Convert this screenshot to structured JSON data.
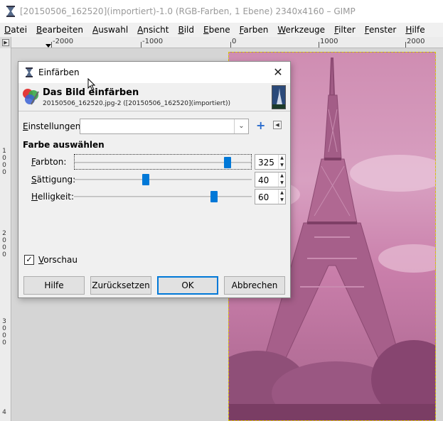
{
  "window": {
    "title": "[20150506_162520](importiert)-1.0 (RGB-Farben, 1 Ebene) 2340x4160 – GIMP"
  },
  "menubar": {
    "items": [
      "Datei",
      "Bearbeiten",
      "Auswahl",
      "Ansicht",
      "Bild",
      "Ebene",
      "Farben",
      "Werkzeuge",
      "Filter",
      "Fenster",
      "Hilfe"
    ]
  },
  "ruler": {
    "h_labels": [
      "-2000",
      "-1000",
      "0",
      "1000",
      "2000"
    ],
    "v_labels": [
      "1\n0\n0\n0",
      "2\n0\n0\n0",
      "3\n0\n0\n0",
      "4"
    ]
  },
  "dialog": {
    "title": "Einfärben",
    "header_title": "Das Bild einfärben",
    "header_subtitle": "20150506_162520.jpg-2 ([20150506_162520](importiert))",
    "settings_label": "Einstellungen:",
    "settings_value": "",
    "section_title": "Farbe auswählen",
    "sliders": [
      {
        "label": "Farbton:",
        "value": "325",
        "fraction": 0.883
      },
      {
        "label": "Sättigung:",
        "value": "40",
        "fraction": 0.4
      },
      {
        "label": "Helligkeit:",
        "value": "60",
        "fraction": 0.8
      }
    ],
    "preview_label": "Vorschau",
    "preview_checked": true,
    "buttons": {
      "help": "Hilfe",
      "reset": "Zurücksetzen",
      "ok": "OK",
      "cancel": "Abbrechen"
    }
  },
  "colors": {
    "accent": "#0078d7",
    "tint": "#cf8db2"
  }
}
